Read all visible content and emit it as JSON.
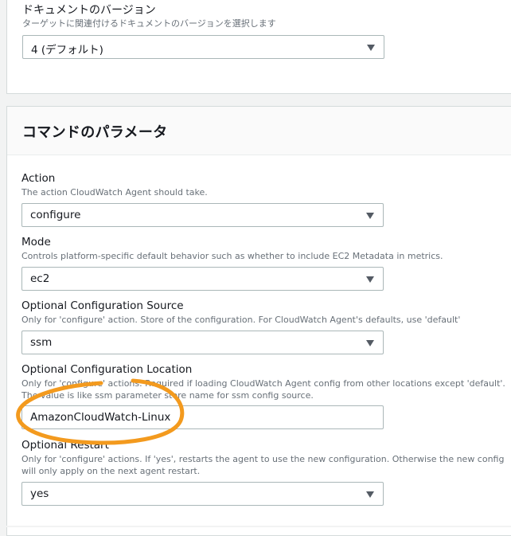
{
  "document_version": {
    "label": "ドキュメントのバージョン",
    "description": "ターゲットに関連付けるドキュメントのバージョンを選択します",
    "value": "4 (デフォルト)"
  },
  "params": {
    "title": "コマンドのパラメータ",
    "action": {
      "label": "Action",
      "description": "The action CloudWatch Agent should take.",
      "value": "configure"
    },
    "mode": {
      "label": "Mode",
      "description": "Controls platform-specific default behavior such as whether to include EC2 Metadata in metrics.",
      "value": "ec2"
    },
    "config_source": {
      "label": "Optional Configuration Source",
      "description": "Only for 'configure' action. Store of the configuration. For CloudWatch Agent's defaults, use 'default'",
      "value": "ssm"
    },
    "config_location": {
      "label": "Optional Configuration Location",
      "description_line1": "Only for 'configure' actions. Required if loading CloudWatch Agent config from other locations except 'default'.",
      "description_line2": "The value is like ssm parameter store name for ssm config source.",
      "value": "AmazonCloudWatch-Linux"
    },
    "restart": {
      "label": "Optional Restart",
      "description_line1": "Only for 'configure' actions. If 'yes', restarts the agent to use the new configuration. Otherwise the new config",
      "description_line2": "will only apply on the next agent restart.",
      "value": "yes"
    }
  },
  "colors": {
    "highlight": "#f39a1e",
    "border": "#aab7b8",
    "muted": "#687078"
  }
}
